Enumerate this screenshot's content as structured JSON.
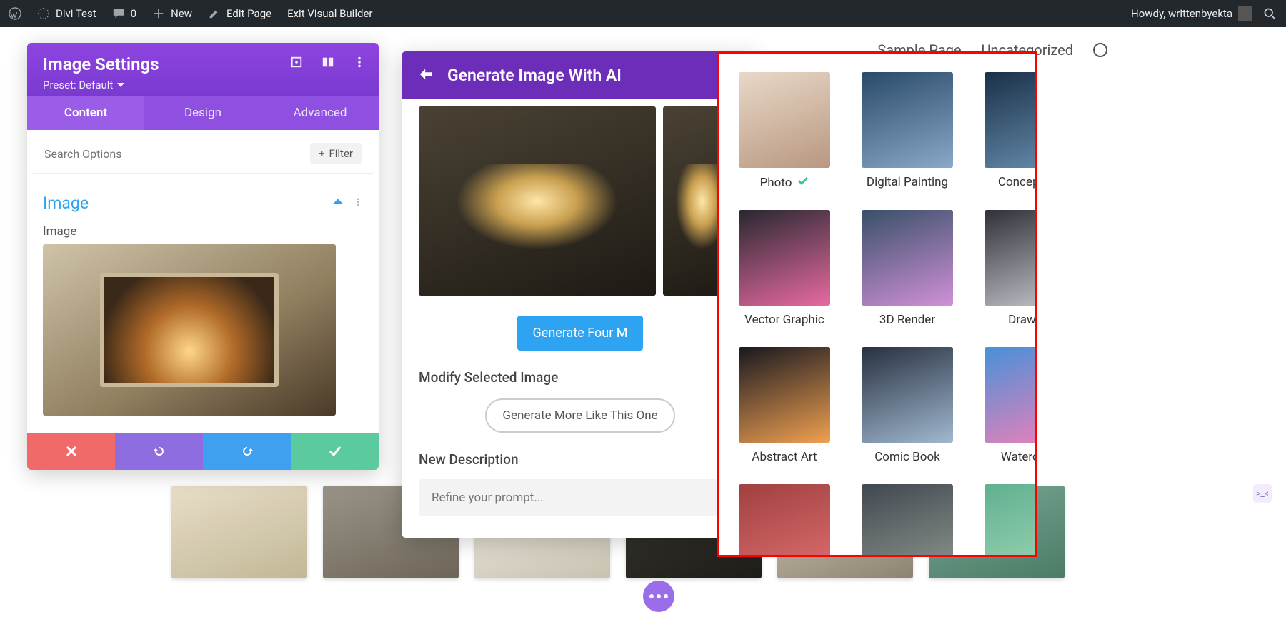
{
  "admin_bar": {
    "site_name": "Divi Test",
    "comments_count": "0",
    "new_label": "New",
    "edit_page": "Edit Page",
    "exit_vb": "Exit Visual Builder",
    "howdy": "Howdy, writtenbyekta"
  },
  "page_nav": {
    "sample": "Sample Page",
    "uncat": "Uncategorized"
  },
  "settings_panel": {
    "title": "Image Settings",
    "preset": "Preset: Default",
    "tabs": {
      "content": "Content",
      "design": "Design",
      "advanced": "Advanced"
    },
    "search_placeholder": "Search Options",
    "filter_label": "Filter",
    "section_label": "Image",
    "field_label": "Image"
  },
  "ai_modal": {
    "title": "Generate Image With AI",
    "generate_btn": "Generate Four M",
    "modify_heading": "Modify Selected Image",
    "more_like_btn": "Generate More Like This One",
    "new_desc_heading": "New Description",
    "refine_placeholder": "Refine your prompt..."
  },
  "style_pop": {
    "selected": "Photo",
    "items": [
      "Photo",
      "Digital Painting",
      "Concept Art",
      "Vector Graphic",
      "3D Render",
      "Drawing",
      "Abstract Art",
      "Comic Book",
      "Watercolor"
    ]
  },
  "side_tag": ">_<"
}
